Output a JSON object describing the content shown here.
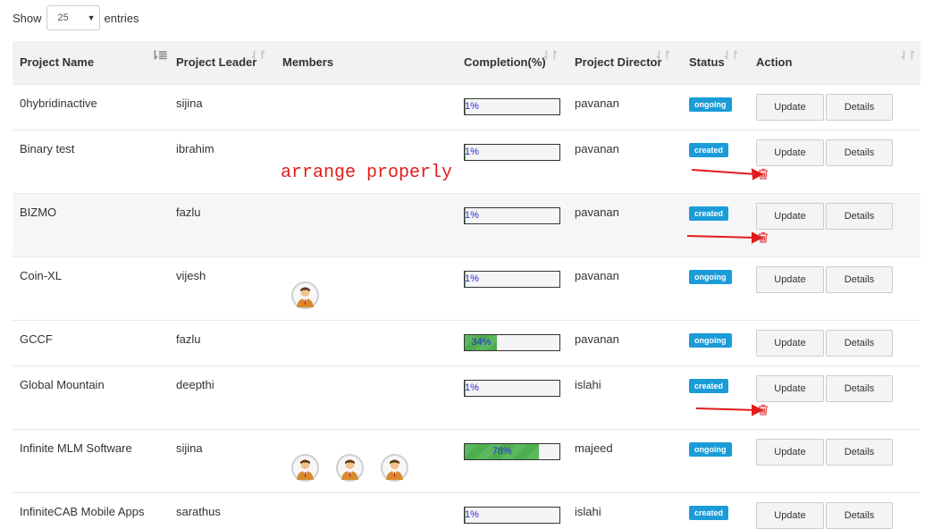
{
  "length_menu": {
    "show_label": "Show",
    "selected": "25",
    "entries_label": "entries"
  },
  "table": {
    "headers": {
      "project_name": "Project Name",
      "project_leader": "Project Leader",
      "members": "Members",
      "completion": "Completion(%)",
      "project_director": "Project Director",
      "status": "Status",
      "action": "Action"
    },
    "buttons": {
      "update": "Update",
      "details": "Details"
    },
    "rows": [
      {
        "name": "0hybridinactive",
        "leader": "sijina",
        "completion": "1%",
        "completion_value": 1,
        "director": "pavanan",
        "status": "ongoing",
        "member_count": 0
      },
      {
        "name": "Binary test",
        "leader": "ibrahim",
        "completion": "1%",
        "completion_value": 1,
        "director": "pavanan",
        "status": "created",
        "member_count": 0
      },
      {
        "name": "BIZMO",
        "leader": "fazlu",
        "completion": "1%",
        "completion_value": 1,
        "director": "pavanan",
        "status": "created",
        "member_count": 0
      },
      {
        "name": "Coin-XL",
        "leader": "vijesh",
        "completion": "1%",
        "completion_value": 1,
        "director": "pavanan",
        "status": "ongoing",
        "member_count": 1
      },
      {
        "name": "GCCF",
        "leader": "fazlu",
        "completion": "34%",
        "completion_value": 34,
        "director": "pavanan",
        "status": "ongoing",
        "member_count": 0
      },
      {
        "name": "Global Mountain",
        "leader": "deepthi",
        "completion": "1%",
        "completion_value": 1,
        "director": "islahi",
        "status": "created",
        "member_count": 0
      },
      {
        "name": "Infinite MLM Software",
        "leader": "sijina",
        "completion": "78%",
        "completion_value": 78,
        "director": "majeed",
        "status": "ongoing",
        "member_count": 3
      },
      {
        "name": "InfiniteCAB Mobile Apps",
        "leader": "sarathus",
        "completion": "1%",
        "completion_value": 1,
        "director": "islahi",
        "status": "created",
        "member_count": 0
      }
    ]
  },
  "annotation": {
    "text": "arrange properly",
    "color": "#e21b1b"
  },
  "colors": {
    "badge": "#1b9cd8",
    "progress": "#5cb85c",
    "progress_text": "#2b2bd6",
    "delete_icon": "#e04b4b"
  }
}
